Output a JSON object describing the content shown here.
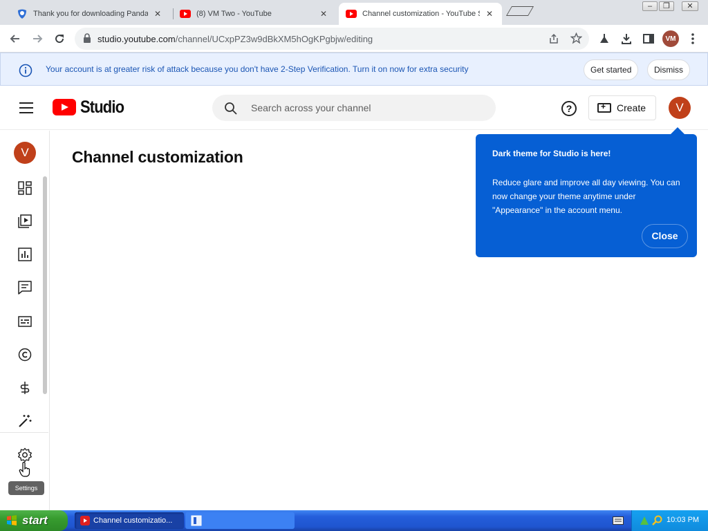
{
  "browser": {
    "tabs": [
      {
        "title": "Thank you for downloading Panda S",
        "active": false
      },
      {
        "title": "(8) VM Two - YouTube",
        "active": false
      },
      {
        "title": "Channel customization - YouTube St",
        "active": true
      }
    ],
    "url_host": "studio.youtube.com",
    "url_path": "/channel/UCxpPZ3w9dBkXM5hOgKPgbjw/editing",
    "profile_initials": "VM"
  },
  "banner": {
    "message": "Your account is at greater risk of attack because you don't have 2-Step Verification. Turn it on now for extra security",
    "get_started": "Get started",
    "dismiss": "Dismiss"
  },
  "header": {
    "logo_text": "Studio",
    "search_placeholder": "Search across your channel",
    "create_label": "Create",
    "avatar_letter": "V"
  },
  "sidebar": {
    "avatar_letter": "V",
    "items": [
      {
        "icon": "dashboard-icon"
      },
      {
        "icon": "content-icon"
      },
      {
        "icon": "analytics-icon"
      },
      {
        "icon": "comments-icon"
      },
      {
        "icon": "subtitles-icon"
      },
      {
        "icon": "copyright-icon"
      },
      {
        "icon": "earn-icon"
      },
      {
        "icon": "customization-icon"
      },
      {
        "icon": "settings-icon"
      }
    ],
    "tooltip": "Settings"
  },
  "main": {
    "title": "Channel customization"
  },
  "callout": {
    "title": "Dark theme for Studio is here!",
    "body": "Reduce glare and improve all day viewing. You can now change your theme anytime under \"Appearance\" in the account menu.",
    "close_label": "Close"
  },
  "taskbar": {
    "start_label": "start",
    "task_label": "Channel customizatio...",
    "clock": "10:03 PM"
  },
  "colors": {
    "brand_red": "#ff0000",
    "callout_blue": "#065fd4",
    "banner_bg": "#e8f0fe",
    "avatar": "#c0401a"
  }
}
